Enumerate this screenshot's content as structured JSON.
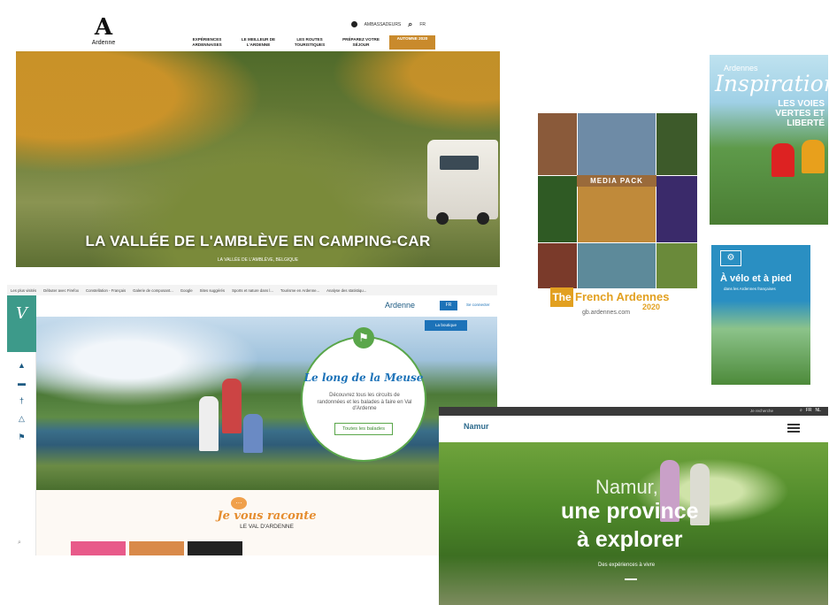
{
  "ardenne_site": {
    "logo_text": "Ardenne",
    "util": {
      "ambassadors": "AMBASSADEURS",
      "lang": "FR"
    },
    "menu": [
      {
        "label": "EXPÉRIENCES ARDENNAISES"
      },
      {
        "label": "LE MEILLEUR DE L'ARDENNE"
      },
      {
        "label": "LES ROUTES TOURISTIQUES"
      },
      {
        "label": "PRÉPAREZ VOTRE SÉJOUR"
      },
      {
        "label": "AUTOMNE 2020"
      }
    ],
    "hero_title": "LA VALLÉE DE L'AMBLÈVE EN CAMPING-CAR",
    "hero_subtitle": "LA VALLÉE DE L'AMBLÈVE, BELGIQUE",
    "accent": "#c98a2c"
  },
  "brochure_media_pack": {
    "band": "MEDIA PACK",
    "the": "The",
    "title": "French Ardennes",
    "year": "2020",
    "url": "gb.ardennes.com",
    "accent": "#e2a020"
  },
  "brochure_inspiration": {
    "brand": "Ardennes",
    "title": "Inspiration",
    "subtitle": "LES VOIES VERTES ET LIBERTÉ"
  },
  "brochure_velo": {
    "title": "À vélo et à pied",
    "subtitle": "dans les Ardennes françaises"
  },
  "val_ardenne_site": {
    "bookmarks": [
      "Les plus visités",
      "Débuter avec Firefox",
      "Constellation - Français",
      "Galerie de composant...",
      "Google",
      "Sites suggérés",
      "Sports et nature dans l...",
      "Tourisme en Ardenne...",
      "Analyse des statistiqu..."
    ],
    "logo": "Ardenne",
    "lang": "FR",
    "connect": "Se connecter",
    "shop": "La boutique",
    "circle_title": "Le long de la Meuse",
    "circle_desc": "Découvrez tous les circuits de randonnées et les balades à faire en Val d'Ardenne",
    "circle_button": "Toutes les balades",
    "raconte_title": "Je vous raconte",
    "raconte_sub": "LE VAL D'ARDENNE",
    "brand_color": "#1c72b8",
    "green": "#5aa64a"
  },
  "namur_site": {
    "search_placeholder": "Je recherche",
    "langs": [
      "FR",
      "NL"
    ],
    "logo": "Namur",
    "title_line1": "Namur,",
    "title_line2": "une province",
    "title_line3": "à explorer",
    "tagline": "Des expériences à vivre"
  }
}
